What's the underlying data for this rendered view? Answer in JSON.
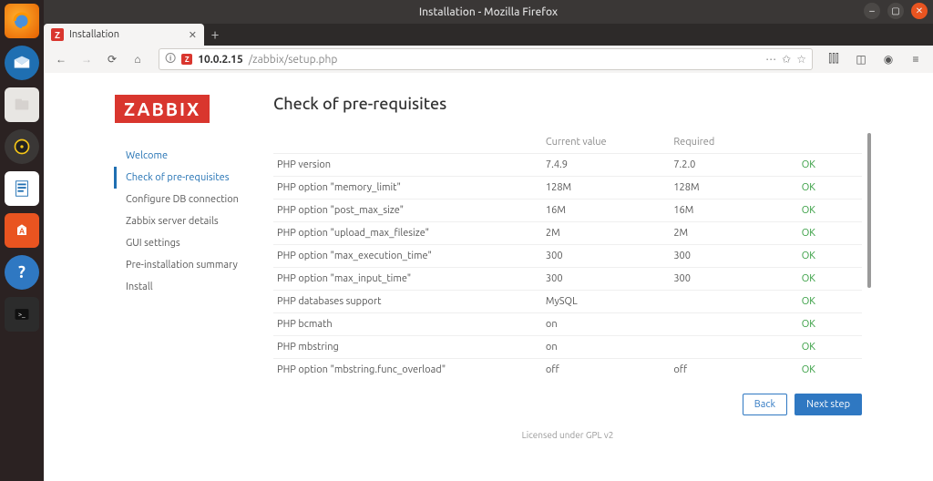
{
  "window": {
    "title": "Installation - Mozilla Firefox"
  },
  "tab": {
    "title": "Installation"
  },
  "url": {
    "host": "10.0.2.15",
    "path": "/zabbix/setup.php"
  },
  "dock": {
    "items": [
      "firefox-icon",
      "thunderbird-icon",
      "files-icon",
      "rhythmbox-icon",
      "libreoffice-icon",
      "software-icon",
      "help-icon",
      "terminal-icon"
    ]
  },
  "page": {
    "logo": "ZABBIX",
    "title": "Check of pre-requisites",
    "steps": [
      {
        "label": "Welcome",
        "state": "done"
      },
      {
        "label": "Check of pre-requisites",
        "state": "active"
      },
      {
        "label": "Configure DB connection",
        "state": ""
      },
      {
        "label": "Zabbix server details",
        "state": ""
      },
      {
        "label": "GUI settings",
        "state": ""
      },
      {
        "label": "Pre-installation summary",
        "state": ""
      },
      {
        "label": "Install",
        "state": ""
      }
    ],
    "headers": {
      "name": "",
      "current": "Current value",
      "required": "Required",
      "status": ""
    },
    "rows": [
      {
        "name": "PHP version",
        "current": "7.4.9",
        "required": "7.2.0",
        "status": "OK"
      },
      {
        "name": "PHP option \"memory_limit\"",
        "current": "128M",
        "required": "128M",
        "status": "OK"
      },
      {
        "name": "PHP option \"post_max_size\"",
        "current": "16M",
        "required": "16M",
        "status": "OK"
      },
      {
        "name": "PHP option \"upload_max_filesize\"",
        "current": "2M",
        "required": "2M",
        "status": "OK"
      },
      {
        "name": "PHP option \"max_execution_time\"",
        "current": "300",
        "required": "300",
        "status": "OK"
      },
      {
        "name": "PHP option \"max_input_time\"",
        "current": "300",
        "required": "300",
        "status": "OK"
      },
      {
        "name": "PHP databases support",
        "current": "MySQL",
        "required": "",
        "status": "OK"
      },
      {
        "name": "PHP bcmath",
        "current": "on",
        "required": "",
        "status": "OK"
      },
      {
        "name": "PHP mbstring",
        "current": "on",
        "required": "",
        "status": "OK"
      },
      {
        "name": "PHP option \"mbstring.func_overload\"",
        "current": "off",
        "required": "off",
        "status": "OK"
      }
    ],
    "buttons": {
      "back": "Back",
      "next": "Next step"
    },
    "license": "Licensed under GPL v2"
  }
}
